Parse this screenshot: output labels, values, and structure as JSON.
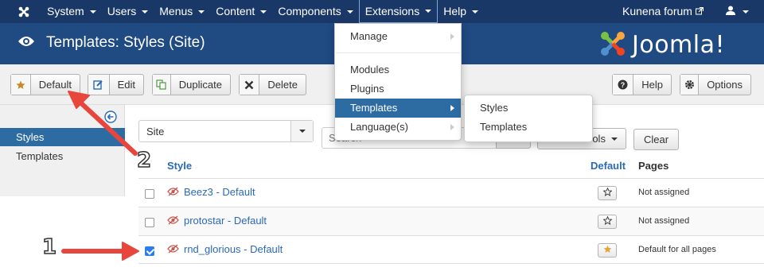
{
  "navbar": {
    "menu": [
      "System",
      "Users",
      "Menus",
      "Content",
      "Components",
      "Extensions",
      "Help"
    ],
    "site_link": "Kunena forum"
  },
  "header": {
    "title": "Templates: Styles (Site)",
    "brand": "Joomla!"
  },
  "toolbar": {
    "default_label": "Default",
    "edit_label": "Edit",
    "duplicate_label": "Duplicate",
    "delete_label": "Delete",
    "help_label": "Help",
    "options_label": "Options"
  },
  "sidebar": {
    "items": [
      {
        "label": "Styles",
        "active": true
      },
      {
        "label": "Templates",
        "active": false
      }
    ]
  },
  "filter": {
    "client_select": "Site",
    "search_placeholder": "Search",
    "search_tools_label": "Search Tools",
    "clear_label": "Clear"
  },
  "table": {
    "headers": {
      "style": "Style",
      "default": "Default",
      "pages": "Pages"
    },
    "rows": [
      {
        "name": "Beez3 - Default",
        "default": false,
        "pages": "Not assigned",
        "checked": false
      },
      {
        "name": "protostar - Default",
        "default": false,
        "pages": "Not assigned",
        "checked": false
      },
      {
        "name": "rnd_glorious - Default",
        "default": true,
        "pages": "Default for all pages",
        "checked": true
      }
    ]
  },
  "extensions_menu": {
    "items": [
      "Manage",
      "Modules",
      "Plugins",
      "Templates",
      "Language(s)"
    ],
    "templates_submenu": [
      "Styles",
      "Templates"
    ]
  },
  "annotations": {
    "label_1": "1",
    "label_2": "2"
  },
  "colors": {
    "navbar": "#1a3867",
    "header": "#1f4a82",
    "active": "#2d6ca2",
    "link": "#2a69b8",
    "arrow": "#e8453c",
    "star_default": "#e8a33c"
  }
}
